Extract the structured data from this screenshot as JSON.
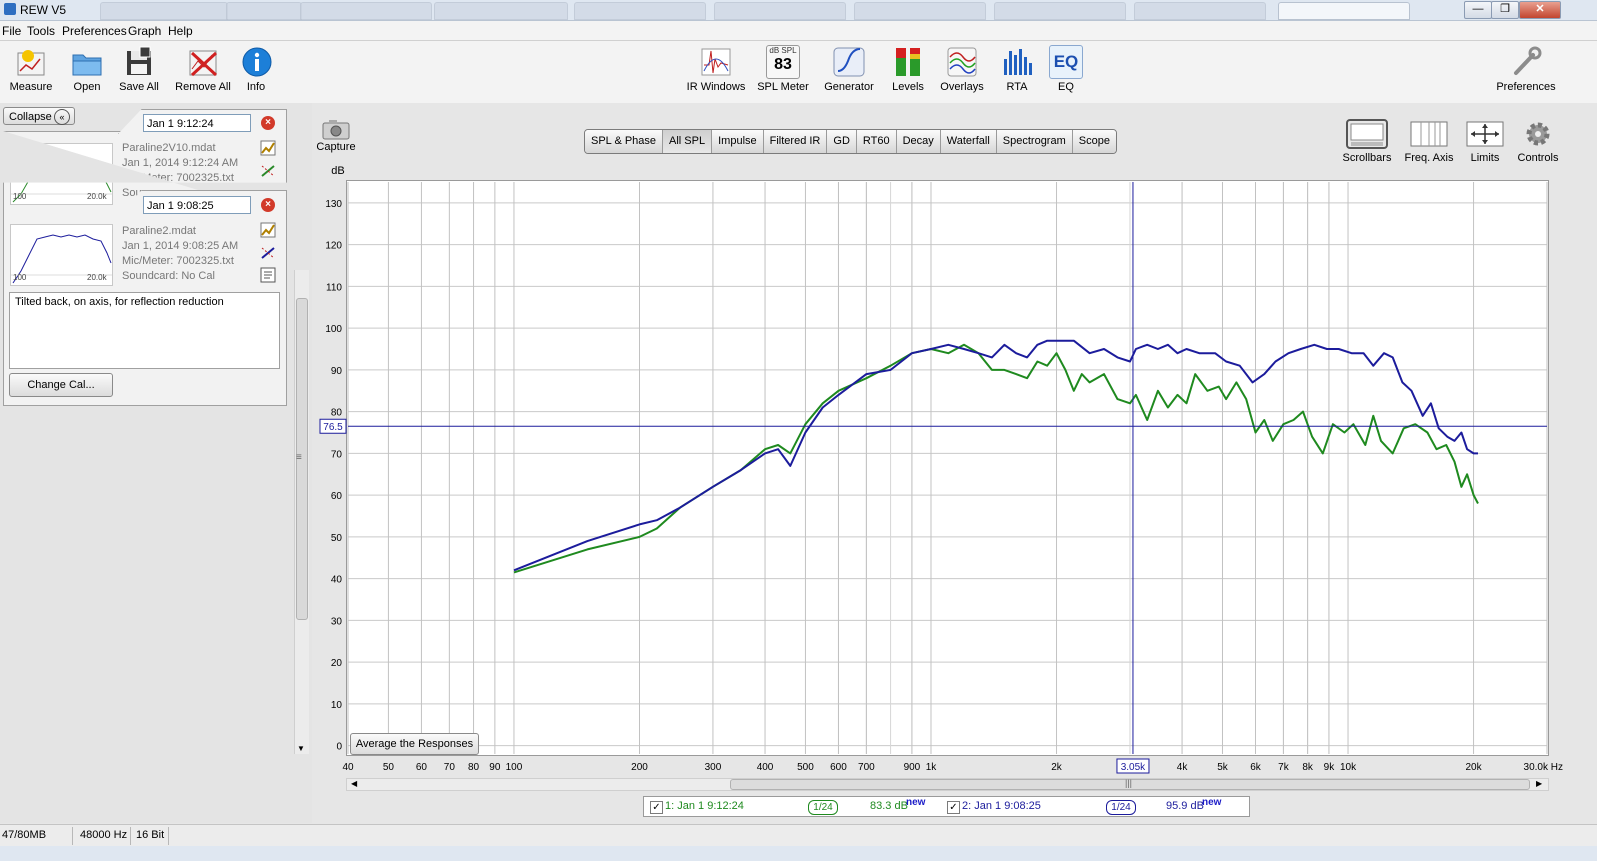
{
  "window": {
    "title": "REW V5",
    "buttons": [
      "—",
      "❐",
      "✕"
    ]
  },
  "menu": [
    "File",
    "Tools",
    "Preferences",
    "Graph",
    "Help"
  ],
  "toolbar_left": [
    {
      "label": "Measure",
      "icon": "measure-icon"
    },
    {
      "label": "Open",
      "icon": "folder-icon"
    },
    {
      "label": "Save All",
      "icon": "save-icon"
    },
    {
      "label": "Remove All",
      "icon": "remove-icon"
    },
    {
      "label": "Info",
      "icon": "info-icon"
    }
  ],
  "toolbar_center": [
    {
      "label": "IR Windows",
      "icon": "ir-windows-icon"
    },
    {
      "label": "SPL Meter",
      "icon": "spl-meter-icon",
      "badge_top": "dB SPL",
      "badge_value": "83"
    },
    {
      "label": "Generator",
      "icon": "generator-icon"
    },
    {
      "label": "Levels",
      "icon": "levels-icon"
    },
    {
      "label": "Overlays",
      "icon": "overlays-icon"
    },
    {
      "label": "RTA",
      "icon": "rta-icon"
    },
    {
      "label": "EQ",
      "icon": "eq-icon",
      "badge_value": "EQ"
    }
  ],
  "toolbar_right": {
    "label": "Preferences",
    "icon": "wrench-icon"
  },
  "graph_controls": [
    {
      "label": "Scrollbars",
      "icon": "scrollbars-icon"
    },
    {
      "label": "Freq. Axis",
      "icon": "freq-axis-icon"
    },
    {
      "label": "Limits",
      "icon": "limits-icon"
    },
    {
      "label": "Controls",
      "icon": "gear-icon"
    }
  ],
  "capture": {
    "label": "Capture",
    "icon": "camera-icon"
  },
  "left_panel": {
    "collapse_label": "Collapse",
    "measurements": [
      {
        "index": "1",
        "name_field": "Jan 1 9:12:24",
        "file": "Paraline2V10.mdat",
        "date": "Jan 1, 2014 9:12:24 AM",
        "mic": "Mic/Meter: 7002325.txt",
        "soundcard": "Sou",
        "thumb_min": "100",
        "thumb_max": "20.0k",
        "color": "#2a8a2a"
      },
      {
        "index": "2",
        "name_field": "Jan 1 9:08:25",
        "file": "Paraline2.mdat",
        "date": "Jan 1, 2014 9:08:25 AM",
        "mic": "Mic/Meter: 7002325.txt",
        "soundcard": "Soundcard: No Cal",
        "thumb_min": "100",
        "thumb_max": "20.0k",
        "color": "#1c1c9c"
      }
    ],
    "notes": "Tilted back, on axis, for reflection reduction",
    "change_cal_label": "Change Cal..."
  },
  "graph_tabs": [
    "SPL & Phase",
    "All SPL",
    "Impulse",
    "Filtered IR",
    "GD",
    "RT60",
    "Decay",
    "Waterfall",
    "Spectrogram",
    "Scope"
  ],
  "active_tab": "All SPL",
  "average_button": "Average the Responses",
  "cursor": {
    "freq_label": "3.05k",
    "level_label": "76.5"
  },
  "chart_data": {
    "type": "line",
    "ylabel": "dB",
    "xunit": "Hz",
    "x_scale": "log",
    "xlim": [
      40,
      30000
    ],
    "ylim": [
      -2,
      135
    ],
    "yticks": [
      0,
      10,
      20,
      30,
      40,
      50,
      60,
      70,
      80,
      90,
      100,
      110,
      120,
      130
    ],
    "xticks": [
      {
        "v": 40,
        "t": "40"
      },
      {
        "v": 50,
        "t": "50"
      },
      {
        "v": 60,
        "t": "60"
      },
      {
        "v": 70,
        "t": "70"
      },
      {
        "v": 80,
        "t": "80"
      },
      {
        "v": 90,
        "t": "90"
      },
      {
        "v": 100,
        "t": "100"
      },
      {
        "v": 200,
        "t": "200"
      },
      {
        "v": 300,
        "t": "300"
      },
      {
        "v": 400,
        "t": "400"
      },
      {
        "v": 500,
        "t": "500"
      },
      {
        "v": 600,
        "t": "600"
      },
      {
        "v": 700,
        "t": "700"
      },
      {
        "v": 900,
        "t": "900"
      },
      {
        "v": 1000,
        "t": "1k"
      },
      {
        "v": 2000,
        "t": "2k"
      },
      {
        "v": 4000,
        "t": "4k"
      },
      {
        "v": 5000,
        "t": "5k"
      },
      {
        "v": 6000,
        "t": "6k"
      },
      {
        "v": 7000,
        "t": "7k"
      },
      {
        "v": 8000,
        "t": "8k"
      },
      {
        "v": 9000,
        "t": "9k"
      },
      {
        "v": 10000,
        "t": "10k"
      },
      {
        "v": 20000,
        "t": "20k"
      },
      {
        "v": 30000,
        "t": "30.0k Hz"
      }
    ],
    "minor_x_lines": [
      400,
      600,
      700,
      800,
      900,
      3000,
      4000,
      5000,
      6000,
      7000,
      8000,
      9000
    ],
    "cursor_x": 3050,
    "cursor_y": 76.5,
    "series": [
      {
        "name": "1: Jan 1 9:12:24",
        "color": "#1f8a1f",
        "points": [
          [
            100,
            41.5
          ],
          [
            150,
            47
          ],
          [
            200,
            50
          ],
          [
            220,
            52
          ],
          [
            250,
            57
          ],
          [
            300,
            62
          ],
          [
            350,
            66
          ],
          [
            400,
            71
          ],
          [
            430,
            72
          ],
          [
            460,
            70
          ],
          [
            500,
            77
          ],
          [
            550,
            82
          ],
          [
            600,
            85
          ],
          [
            700,
            88
          ],
          [
            800,
            91
          ],
          [
            900,
            94
          ],
          [
            1000,
            95
          ],
          [
            1100,
            94
          ],
          [
            1200,
            96
          ],
          [
            1300,
            94
          ],
          [
            1400,
            90
          ],
          [
            1500,
            90
          ],
          [
            1600,
            89
          ],
          [
            1700,
            88
          ],
          [
            1800,
            92
          ],
          [
            1900,
            91
          ],
          [
            2000,
            94
          ],
          [
            2100,
            90
          ],
          [
            2200,
            85
          ],
          [
            2300,
            89
          ],
          [
            2400,
            87
          ],
          [
            2600,
            89
          ],
          [
            2800,
            83
          ],
          [
            3000,
            82
          ],
          [
            3100,
            84
          ],
          [
            3300,
            78
          ],
          [
            3500,
            85
          ],
          [
            3700,
            81
          ],
          [
            3900,
            84
          ],
          [
            4100,
            82
          ],
          [
            4300,
            89
          ],
          [
            4600,
            85
          ],
          [
            4900,
            86
          ],
          [
            5100,
            83
          ],
          [
            5400,
            87
          ],
          [
            5700,
            83
          ],
          [
            6000,
            75
          ],
          [
            6300,
            78
          ],
          [
            6600,
            73
          ],
          [
            7000,
            77
          ],
          [
            7400,
            78
          ],
          [
            7800,
            80
          ],
          [
            8200,
            74
          ],
          [
            8700,
            70
          ],
          [
            9200,
            77
          ],
          [
            9800,
            75
          ],
          [
            10300,
            77
          ],
          [
            11000,
            72
          ],
          [
            11500,
            79
          ],
          [
            12000,
            73
          ],
          [
            12800,
            70
          ],
          [
            13600,
            76
          ],
          [
            14500,
            77
          ],
          [
            15500,
            75
          ],
          [
            16300,
            71
          ],
          [
            17200,
            72
          ],
          [
            18000,
            68
          ],
          [
            18700,
            62
          ],
          [
            19300,
            65
          ],
          [
            20000,
            60
          ],
          [
            20500,
            58
          ]
        ]
      },
      {
        "name": "2: Jan 1 9:08:25",
        "color": "#1c1c9c",
        "points": [
          [
            100,
            42
          ],
          [
            150,
            49
          ],
          [
            200,
            53
          ],
          [
            220,
            54
          ],
          [
            250,
            57
          ],
          [
            300,
            62
          ],
          [
            350,
            66
          ],
          [
            400,
            70
          ],
          [
            430,
            71
          ],
          [
            460,
            67
          ],
          [
            500,
            75
          ],
          [
            550,
            81
          ],
          [
            600,
            84
          ],
          [
            700,
            89
          ],
          [
            800,
            90
          ],
          [
            900,
            94
          ],
          [
            1000,
            95
          ],
          [
            1100,
            96
          ],
          [
            1200,
            95
          ],
          [
            1300,
            94
          ],
          [
            1400,
            93
          ],
          [
            1500,
            96
          ],
          [
            1600,
            94
          ],
          [
            1700,
            93
          ],
          [
            1800,
            96
          ],
          [
            1900,
            97
          ],
          [
            2000,
            97
          ],
          [
            2200,
            97
          ],
          [
            2400,
            94
          ],
          [
            2600,
            95
          ],
          [
            2800,
            93
          ],
          [
            3000,
            92
          ],
          [
            3100,
            95
          ],
          [
            3300,
            96
          ],
          [
            3500,
            95
          ],
          [
            3700,
            96
          ],
          [
            3900,
            94
          ],
          [
            4100,
            95
          ],
          [
            4400,
            94
          ],
          [
            4800,
            94
          ],
          [
            5100,
            92
          ],
          [
            5500,
            91
          ],
          [
            5900,
            87
          ],
          [
            6300,
            89
          ],
          [
            6700,
            92
          ],
          [
            7200,
            94
          ],
          [
            7700,
            95
          ],
          [
            8300,
            96
          ],
          [
            8900,
            95
          ],
          [
            9500,
            95
          ],
          [
            10200,
            94
          ],
          [
            10900,
            94
          ],
          [
            11500,
            91
          ],
          [
            12200,
            94
          ],
          [
            12800,
            93
          ],
          [
            13500,
            87
          ],
          [
            14200,
            85
          ],
          [
            15100,
            79
          ],
          [
            15800,
            82
          ],
          [
            16500,
            76
          ],
          [
            17300,
            74
          ],
          [
            18000,
            73
          ],
          [
            18700,
            75
          ],
          [
            19300,
            71
          ],
          [
            20000,
            70
          ],
          [
            20500,
            70
          ]
        ]
      }
    ]
  },
  "legend": {
    "items": [
      {
        "label": "1: Jan 1 9:12:24",
        "smoothing": "1/24",
        "value": "83.3 dB",
        "suffix": "new",
        "color": "#1f8a1f"
      },
      {
        "label": "2: Jan 1 9:08:25",
        "smoothing": "1/24",
        "value": "95.9 dB",
        "suffix": "new",
        "color": "#1c1c9c"
      }
    ]
  },
  "status": {
    "memory": "47/80MB",
    "rate": "48000 Hz",
    "bits": "16 Bit"
  }
}
